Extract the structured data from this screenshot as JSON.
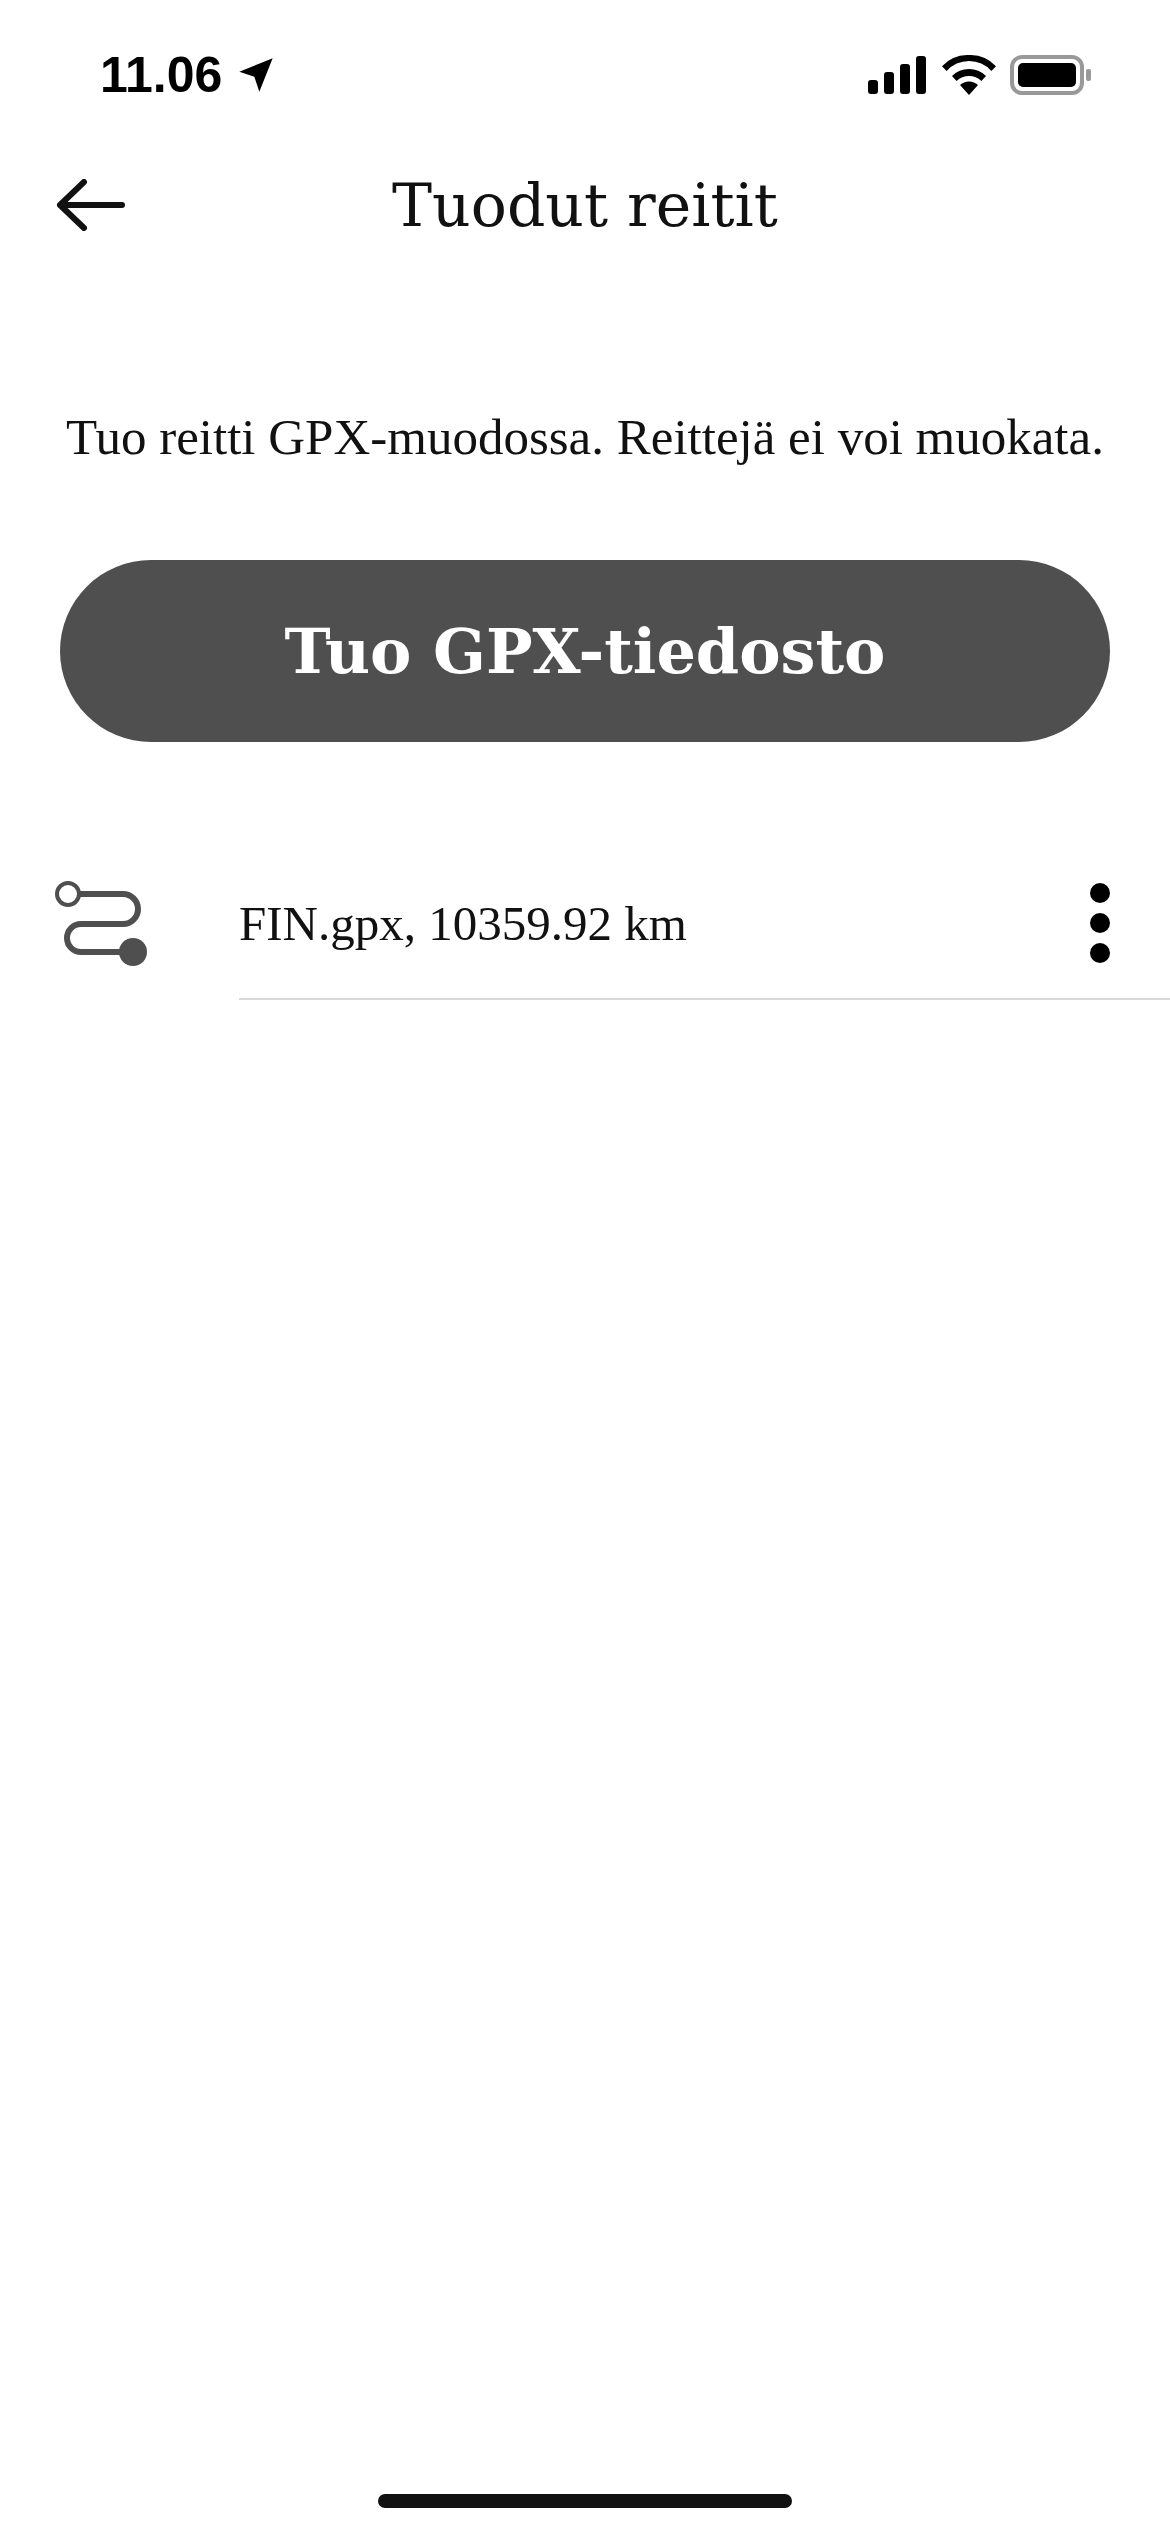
{
  "status_bar": {
    "time": "11.06"
  },
  "header": {
    "title": "Tuodut reitit"
  },
  "description": "Tuo reitti GPX-muodossa. Reittejä ei voi muokata.",
  "import_button": {
    "label": "Tuo GPX-tiedosto"
  },
  "routes": [
    {
      "label": "FIN.gpx, 10359.92 km"
    }
  ]
}
